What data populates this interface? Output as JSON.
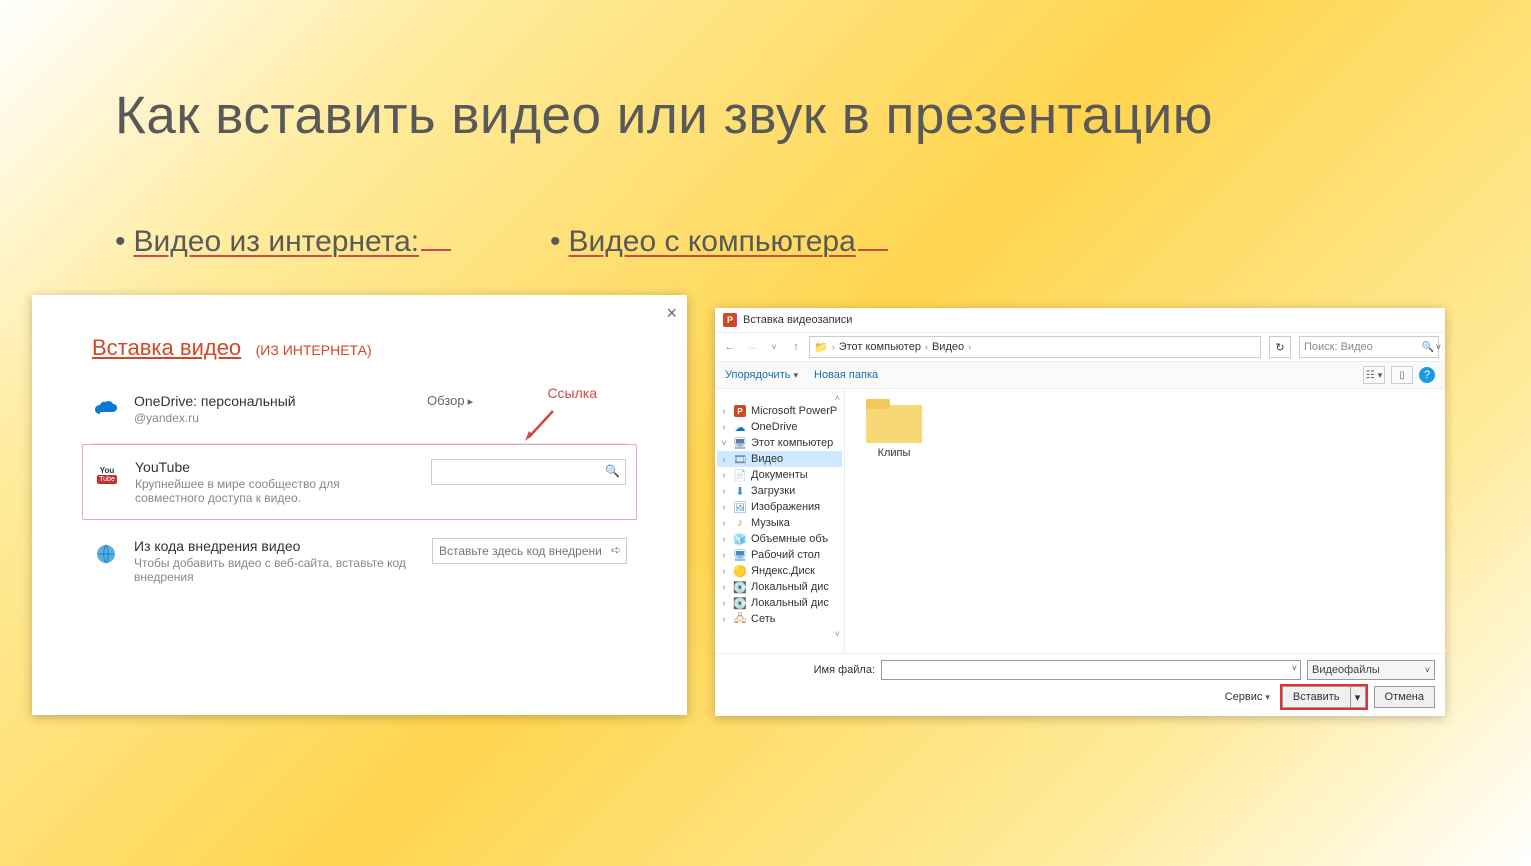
{
  "slide": {
    "title": "Как вставить видео или звук в презентацию"
  },
  "bullets": {
    "left": "Видео из интернета:",
    "right": "Видео  с компьютера"
  },
  "online_panel": {
    "title": "Вставка видео",
    "subtitle": "(ИЗ ИНТЕРНЕТА)",
    "annotation": "Ссылка",
    "onedrive": {
      "title": "OneDrive: персональный",
      "sub": "@yandex.ru",
      "action": "Обзор"
    },
    "youtube": {
      "title": "YouTube",
      "sub": "Крупнейшее в мире сообщество для совместного доступа к видео.",
      "placeholder": ""
    },
    "embed": {
      "title": "Из кода внедрения видео",
      "sub": "Чтобы добавить видео с веб-сайта, вставьте код внедрения",
      "placeholder": "Вставьте здесь код внедрения"
    }
  },
  "file_dialog": {
    "window_title": "Вставка видеозаписи",
    "breadcrumb": [
      "Этот компьютер",
      "Видео"
    ],
    "search_placeholder": "Поиск: Видео",
    "toolbar": {
      "organize": "Упорядочить",
      "new_folder": "Новая папка"
    },
    "tree": [
      {
        "caret": ">",
        "icon": "pp",
        "label": "Microsoft PowerP"
      },
      {
        "caret": ">",
        "icon": "onedrive",
        "label": "OneDrive"
      },
      {
        "caret": "v",
        "icon": "monitor",
        "label": "Этот компьютер"
      },
      {
        "caret": ">",
        "icon": "video",
        "label": "Видео",
        "selected": true
      },
      {
        "caret": ">",
        "icon": "doc",
        "label": "Документы"
      },
      {
        "caret": ">",
        "icon": "dl",
        "label": "Загрузки"
      },
      {
        "caret": ">",
        "icon": "img",
        "label": "Изображения"
      },
      {
        "caret": ">",
        "icon": "music",
        "label": "Музыка"
      },
      {
        "caret": ">",
        "icon": "3d",
        "label": "Объемные объ"
      },
      {
        "caret": ">",
        "icon": "desk",
        "label": "Рабочий стол"
      },
      {
        "caret": ">",
        "icon": "yadisk",
        "label": "Яндекс.Диск"
      },
      {
        "caret": ">",
        "icon": "local",
        "label": "Локальный дис"
      },
      {
        "caret": ">",
        "icon": "local",
        "label": "Локальный дис"
      },
      {
        "caret": ">",
        "icon": "net",
        "label": "Сеть"
      }
    ],
    "folder_item": "Клипы",
    "filename_label": "Имя файла:",
    "filter": "Видеофайлы",
    "service": "Сервис",
    "insert": "Вставить",
    "cancel": "Отмена"
  }
}
